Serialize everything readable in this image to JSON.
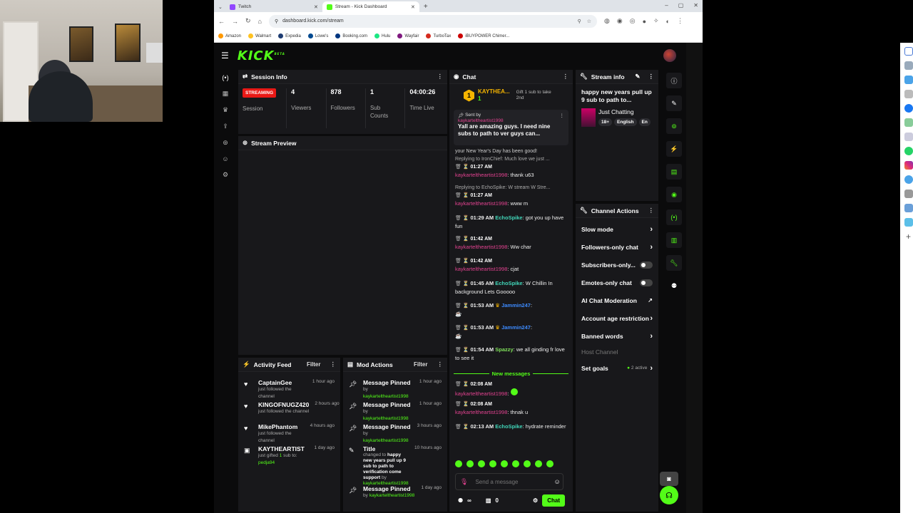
{
  "browser": {
    "tabs": [
      {
        "title": "Twitch",
        "active": false
      },
      {
        "title": "Stream - Kick Dashboard",
        "active": true
      }
    ],
    "url": "dashboard.kick.com/stream",
    "bookmarks": [
      "Amazon",
      "Walmart",
      "Expedia",
      "Lowe's",
      "Booking.com",
      "Hulu",
      "Wayfair",
      "TurboTax",
      "iBUYPOWER Chimer..."
    ]
  },
  "kick": {
    "logo": "KICK",
    "logo_badge": "BETA",
    "session": {
      "title": "Session Info",
      "badge": "STREAMING",
      "session_label": "Session",
      "stats": [
        {
          "value": "4",
          "label": "Viewers"
        },
        {
          "value": "878",
          "label": "Followers"
        },
        {
          "value": "1",
          "label": "Sub Counts"
        },
        {
          "value": "04:00:26",
          "label": "Time Live"
        }
      ]
    },
    "preview": {
      "title": "Stream Preview"
    },
    "activity": {
      "title": "Activity Feed",
      "filter": "Filter",
      "items": [
        {
          "icon": "heart-icon",
          "name": "CaptainGee",
          "sub": "just followed the channel",
          "time": "1 hour ago"
        },
        {
          "icon": "heart-icon",
          "name": "KINGOFNUGZ420",
          "sub": "just followed the channel",
          "time": "2 hours ago"
        },
        {
          "icon": "heart-icon",
          "name": "MikePhantom",
          "sub": "just followed the channel",
          "time": "4 hours ago"
        },
        {
          "icon": "gift-icon",
          "name": "KAYTHEARTIST",
          "sub_a": "just gifted ",
          "sub_b": "1",
          "sub_c": " sub to: ",
          "sub_d": "pedja94",
          "time": "1 day ago"
        }
      ]
    },
    "mod": {
      "title": "Mod Actions",
      "filter": "Filter",
      "items": [
        {
          "icon": "pin-icon",
          "title": "Message Pinned",
          "by": "by",
          "user": "kaykarteltheartist1998",
          "time": "1 hour ago"
        },
        {
          "icon": "pin-icon",
          "title": "Message Pinned",
          "by": "by",
          "user": "kaykarteltheartist1998",
          "time": "1 hour ago"
        },
        {
          "icon": "pin-icon",
          "title": "Message Pinned",
          "by": "by",
          "user": "kaykarteltheartist1998",
          "time": "3 hours ago"
        },
        {
          "icon": "title-edit-icon",
          "title": "Title",
          "changed": "changed to",
          "new_title": "happy new years pull up 9 sub to path to verification come support",
          "by": "by",
          "user": "kaykarteltheartist1998",
          "time": "10 hours ago"
        },
        {
          "icon": "pin-icon",
          "title": "Message Pinned",
          "by": "by",
          "user": "kaykarteltheartist1998",
          "time": "1 day ago"
        }
      ]
    },
    "chat": {
      "title": "Chat",
      "gifter": {
        "rank": "1",
        "name": "KAYTHEA...",
        "count": "1",
        "cta": "Gift 1 sub to take 2nd"
      },
      "pinned": {
        "label": "Sent by",
        "user": "kaykarteltheartist1998",
        "text": "Yall are amazing guys. I need nine subs to path to ver guys can..."
      },
      "partial_line": "your New Year's Day has been good!",
      "messages": [
        {
          "reply": "Replying to IronChief: Much love we just ...",
          "time": "01:27 AM",
          "user": "kaykarteltheartist1998",
          "text": ": thank u63"
        },
        {
          "reply": "Replying to EchoSpike: W stream W Stre...",
          "time": "01:27 AM",
          "user": "kaykarteltheartist1998",
          "text": ": www m"
        },
        {
          "time": "01:29 AM",
          "user": "EchoSpike",
          "text": ": got you up have fun"
        },
        {
          "time": "01:42 AM",
          "user": "kaykarteltheartist1998",
          "text": ": Ww char"
        },
        {
          "time": "01:42 AM",
          "user": "kaykarteltheartist1998",
          "text": ": cjat"
        },
        {
          "time": "01:45 AM",
          "user": "EchoSpike",
          "text": ": W Chillin In background Lets Gooooo"
        },
        {
          "time": "01:53 AM",
          "user": "Jammin247",
          "text": ":"
        },
        {
          "time": "01:53 AM",
          "user": "Jammin247",
          "text": ":"
        },
        {
          "time": "01:54 AM",
          "user": "Spazzy",
          "text": ": we all ginding fr love to see it"
        }
      ],
      "new_messages_label": "New messages",
      "new_messages": [
        {
          "time": "02:08 AM",
          "user": "kaykarteltheartist1998",
          "text": ":"
        },
        {
          "time": "02:08 AM",
          "user": "kaykarteltheartist1998",
          "text": ": thnak u"
        },
        {
          "time": "02:13 AM",
          "user": "EchoSpike",
          "text": ": hydrate reminder"
        }
      ],
      "input_placeholder": "Send a message",
      "counter_symbol": "∞",
      "points": "0",
      "send_label": "Chat"
    },
    "stream_info": {
      "title": "Stream info",
      "stream_title": "happy new years pull up 9 sub to path to...",
      "category": "Just Chatting",
      "tags": [
        "18+",
        "English",
        "En"
      ]
    },
    "channel_actions": {
      "title": "Channel Actions",
      "items": [
        {
          "label": "Slow mode",
          "type": "arrow"
        },
        {
          "label": "Followers-only chat",
          "type": "arrow"
        },
        {
          "label": "Subscribers-only...",
          "type": "toggle"
        },
        {
          "label": "Emotes-only chat",
          "type": "toggle"
        },
        {
          "label": "AI Chat Moderation",
          "type": "external"
        },
        {
          "label": "Account age restriction",
          "type": "arrow"
        },
        {
          "label": "Banned words",
          "type": "arrow"
        },
        {
          "label": "Host Channel",
          "type": "disabled"
        },
        {
          "label": "Set goals",
          "type": "goal",
          "goal_status": "2 active"
        }
      ]
    }
  }
}
